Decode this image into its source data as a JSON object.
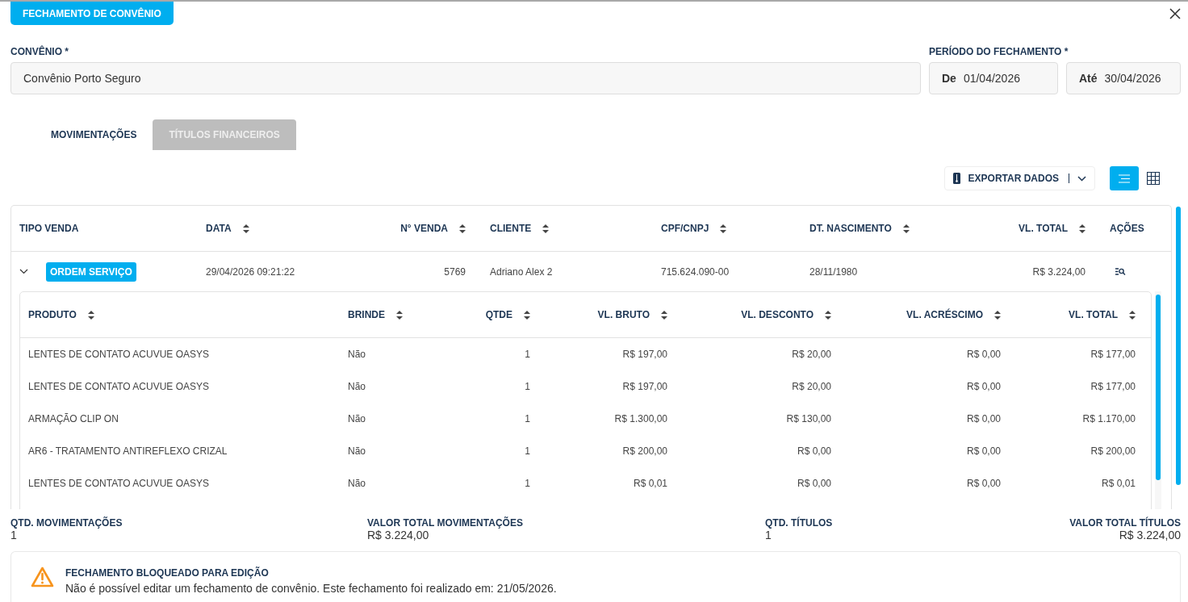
{
  "header": {
    "title": "FECHAMENTO DE CONVÊNIO"
  },
  "form": {
    "convenio": {
      "label": "CONVÊNIO *",
      "value": "Convênio Porto Seguro"
    },
    "periodo": {
      "label": "PERÍODO DO FECHAMENTO *",
      "from": {
        "prefix": "De",
        "value": "01/04/2026"
      },
      "to": {
        "prefix": "Até",
        "value": "30/04/2026"
      }
    }
  },
  "tabs": [
    {
      "label": "MOVIMENTAÇÕES",
      "selected": true
    },
    {
      "label": "TÍTULOS FINANCEIROS",
      "selected": false
    }
  ],
  "toolbar": {
    "export": "EXPORTAR DADOS",
    "views": [
      {
        "kind": "list",
        "selected": true
      },
      {
        "kind": "grid",
        "selected": false
      }
    ]
  },
  "table": {
    "columns": [
      {
        "label": "TIPO VENDA",
        "sortable": false,
        "numeric": false
      },
      {
        "label": "DATA",
        "sortable": true,
        "numeric": false
      },
      {
        "label": "N° VENDA",
        "sortable": true,
        "numeric": true
      },
      {
        "label": "CLIENTE",
        "sortable": true,
        "numeric": false
      },
      {
        "label": "CPF/CNPJ",
        "sortable": true,
        "numeric": false
      },
      {
        "label": "DT. NASCIMENTO",
        "sortable": true,
        "numeric": false
      },
      {
        "label": "VL. TOTAL",
        "sortable": true,
        "numeric": true
      },
      {
        "label": "AÇÕES",
        "sortable": false,
        "numeric": false
      }
    ],
    "rows": [
      {
        "expanded": true,
        "cells": [
          "ORDEM SERVIÇO",
          "29/04/2026 09:21:22",
          "5769",
          "Adriano Alex 2",
          "715.624.090-00",
          "28/11/1980",
          "R$ 3.224,00"
        ],
        "items": {
          "columns": [
            {
              "label": "PRODUTO",
              "sortable": true,
              "numeric": false
            },
            {
              "label": "BRINDE",
              "sortable": true,
              "numeric": false
            },
            {
              "label": "QTDE",
              "sortable": true,
              "numeric": true
            },
            {
              "label": "VL. BRUTO",
              "sortable": true,
              "numeric": true
            },
            {
              "label": "VL. DESCONTO",
              "sortable": true,
              "numeric": true
            },
            {
              "label": "VL. ACRÉSCIMO",
              "sortable": true,
              "numeric": true
            },
            {
              "label": "VL. TOTAL",
              "sortable": true,
              "numeric": true
            }
          ],
          "rows": [
            [
              "LENTES DE CONTATO ACUVUE OASYS",
              "Não",
              "1",
              "R$ 197,00",
              "R$ 20,00",
              "R$ 0,00",
              "R$ 177,00"
            ],
            [
              "LENTES DE CONTATO ACUVUE OASYS",
              "Não",
              "1",
              "R$ 197,00",
              "R$ 20,00",
              "R$ 0,00",
              "R$ 177,00"
            ],
            [
              "ARMAÇÃO CLIP ON",
              "Não",
              "1",
              "R$ 1.300,00",
              "R$ 130,00",
              "R$ 0,00",
              "R$ 1.170,00"
            ],
            [
              "AR6 - TRATAMENTO ANTIREFLEXO CRIZAL",
              "Não",
              "1",
              "R$ 200,00",
              "R$ 0,00",
              "R$ 0,00",
              "R$ 200,00"
            ],
            [
              "LENTES DE CONTATO ACUVUE OASYS",
              "Não",
              "1",
              "R$ 0,01",
              "R$ 0,00",
              "R$ 0,00",
              "R$ 0,01"
            ]
          ]
        }
      }
    ]
  },
  "summary": [
    {
      "label": "QTD. MOVIMENTAÇÕES",
      "value": "1"
    },
    {
      "label": "VALOR TOTAL MOVIMENTAÇÕES",
      "value": "R$ 3.224,00"
    },
    {
      "label": "QTD. TÍTULOS",
      "value": "1"
    },
    {
      "label": "VALOR TOTAL TÍTULOS",
      "value": "R$ 3.224,00"
    }
  ],
  "alert": {
    "title": "FECHAMENTO BLOQUEADO PARA EDIÇÃO",
    "message": "Não é possível editar um fechamento de convênio. Este fechamento foi realizado em: 21/05/2026."
  }
}
